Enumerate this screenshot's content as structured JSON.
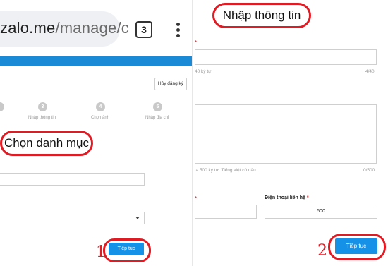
{
  "browser": {
    "url_domain": "zalo.me",
    "url_path": "/manage/c",
    "tab_count": "3"
  },
  "left": {
    "cancel_label": "Hủy đăng ký",
    "steps": [
      {
        "number": "3",
        "label": "Nhập thông tin"
      },
      {
        "number": "4",
        "label": "Chọn ảnh"
      },
      {
        "number": "5",
        "label": "Nhập địa chỉ"
      }
    ],
    "callout": "Chọn danh mục",
    "continue_label": "Tiếp tục",
    "marker": "1"
  },
  "right": {
    "callout": "Nhập thông tin",
    "required_mark": "*",
    "name_hint": "40 ký tự.",
    "name_counter": "4/40",
    "desc_hint": "ia 500 ký tự. Tiếng việt có dấu.",
    "desc_counter": "0/500",
    "phone_label": "Điện thoại liên hệ",
    "phone_value": "500",
    "continue_label": "Tiếp tục",
    "marker": "2"
  },
  "colors": {
    "accent_blue": "#1591e8",
    "callout_red": "#e01b24",
    "header_blue": "#1a8ad6"
  }
}
